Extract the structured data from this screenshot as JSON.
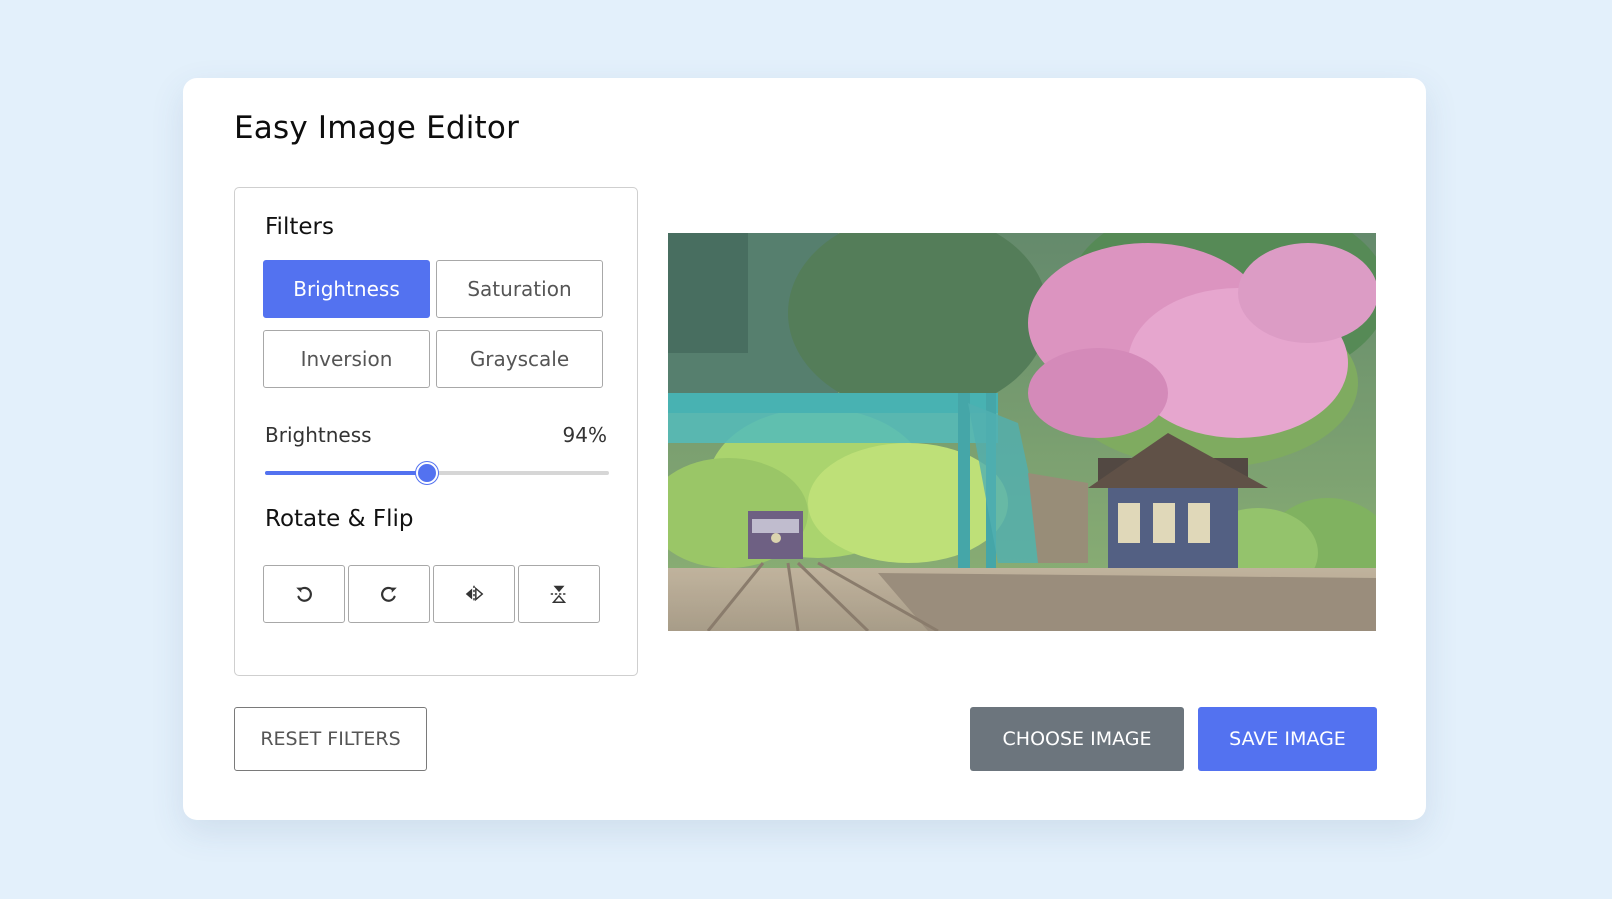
{
  "app": {
    "title": "Easy Image Editor"
  },
  "filters": {
    "heading": "Filters",
    "buttons": [
      {
        "label": "Brightness",
        "active": true
      },
      {
        "label": "Saturation",
        "active": false
      },
      {
        "label": "Inversion",
        "active": false
      },
      {
        "label": "Grayscale",
        "active": false
      }
    ],
    "slider": {
      "label": "Brightness",
      "value_text": "94%",
      "fraction": 0.47
    }
  },
  "rotate_flip": {
    "heading": "Rotate & Flip",
    "buttons": [
      {
        "icon": "rotate-left-icon"
      },
      {
        "icon": "rotate-right-icon"
      },
      {
        "icon": "flip-horizontal-icon"
      },
      {
        "icon": "flip-vertical-icon"
      }
    ]
  },
  "actions": {
    "reset_label": "RESET FILTERS",
    "choose_label": "CHOOSE IMAGE",
    "save_label": "SAVE IMAGE"
  },
  "colors": {
    "accent": "#5372f0",
    "secondary": "#6c757d",
    "background": "#e3f0fb"
  }
}
